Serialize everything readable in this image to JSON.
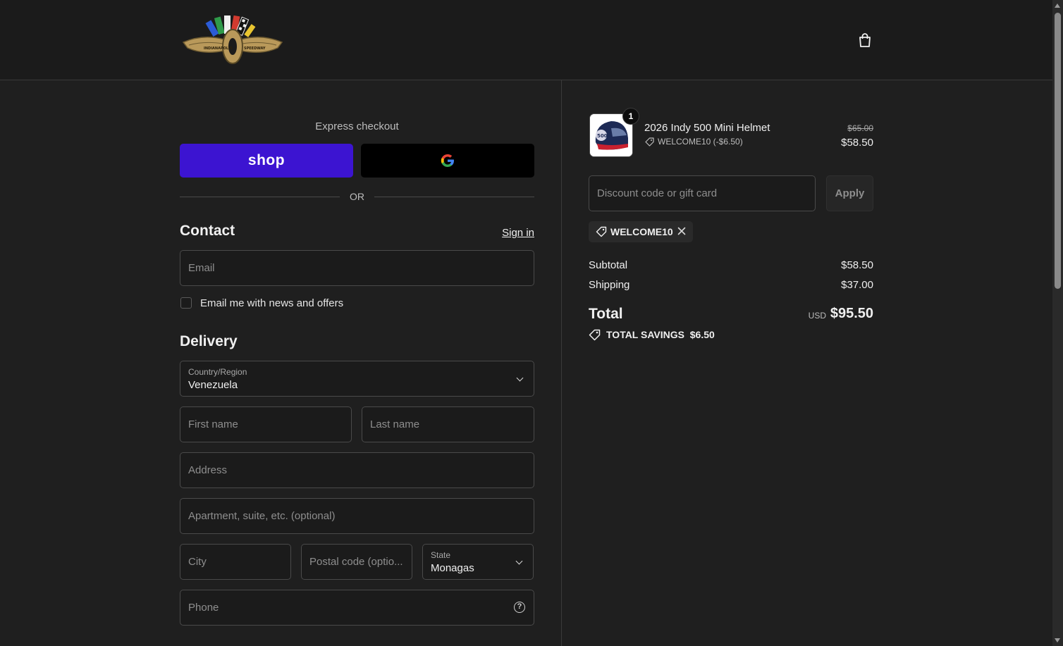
{
  "header": {
    "logo_text_left": "INDIANAPOLIS",
    "logo_text_right": "SPEEDWAY",
    "logo_text_center": "MOTOR"
  },
  "express": {
    "title": "Express checkout",
    "shop_label": "shop",
    "gpay_label": "G",
    "or_text": "OR"
  },
  "contact": {
    "title": "Contact",
    "signin": "Sign in",
    "email_placeholder": "Email",
    "newsletter_label": "Email me with news and offers"
  },
  "delivery": {
    "title": "Delivery",
    "country_label": "Country/Region",
    "country_value": "Venezuela",
    "first_name_placeholder": "First name",
    "last_name_placeholder": "Last name",
    "address_placeholder": "Address",
    "apartment_placeholder": "Apartment, suite, etc. (optional)",
    "city_placeholder": "City",
    "postal_placeholder": "Postal code (optio...",
    "state_label": "State",
    "state_value": "Monagas",
    "phone_placeholder": "Phone",
    "help_glyph": "?"
  },
  "order": {
    "quantity": "1",
    "product_name": "2026 Indy 500 Mini Helmet",
    "product_discount": "WELCOME10 (-$6.50)",
    "price_original": "$65.00",
    "price_current": "$58.50",
    "helmet_text": "500",
    "discount_placeholder": "Discount code or gift card",
    "apply_label": "Apply",
    "applied_code": "WELCOME10",
    "subtotal_label": "Subtotal",
    "subtotal_value": "$58.50",
    "shipping_label": "Shipping",
    "shipping_value": "$37.00",
    "total_label": "Total",
    "total_currency": "USD",
    "total_value": "$95.50",
    "savings_label": "TOTAL SAVINGS",
    "savings_value": "$6.50"
  },
  "colors": {
    "background": "#1f1f1f",
    "shop_purple": "#3c14d1",
    "gpay_black": "#000000"
  }
}
